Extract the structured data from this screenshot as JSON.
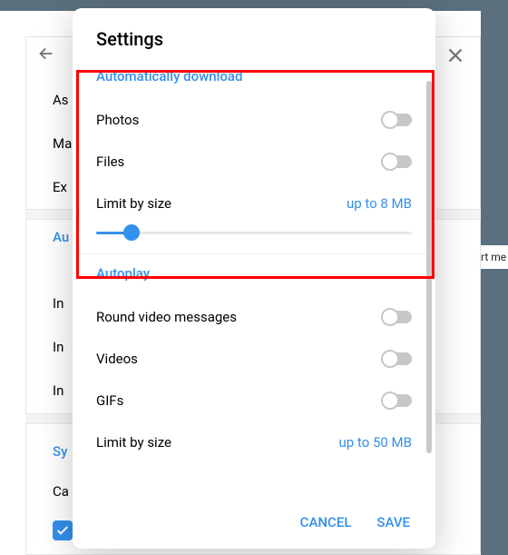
{
  "background": {
    "items": [
      "As",
      "Ma",
      "Ex"
    ],
    "autoHead": "Au",
    "items2": [
      "In",
      "In",
      "In"
    ],
    "syncHead": "Sy",
    "caItem": "Ca",
    "rightBtn": "rt me"
  },
  "modal": {
    "title": "Settings",
    "sections": {
      "auto": {
        "head": "Automatically download",
        "photos": "Photos",
        "files": "Files",
        "limit": "Limit by size",
        "limitVal": "up to 8 MB"
      },
      "autoplay": {
        "head": "Autoplay",
        "round": "Round video messages",
        "videos": "Videos",
        "gifs": "GIFs",
        "limit": "Limit by size",
        "limitVal": "up to 50 MB"
      }
    },
    "footer": {
      "cancel": "CANCEL",
      "save": "SAVE"
    }
  }
}
